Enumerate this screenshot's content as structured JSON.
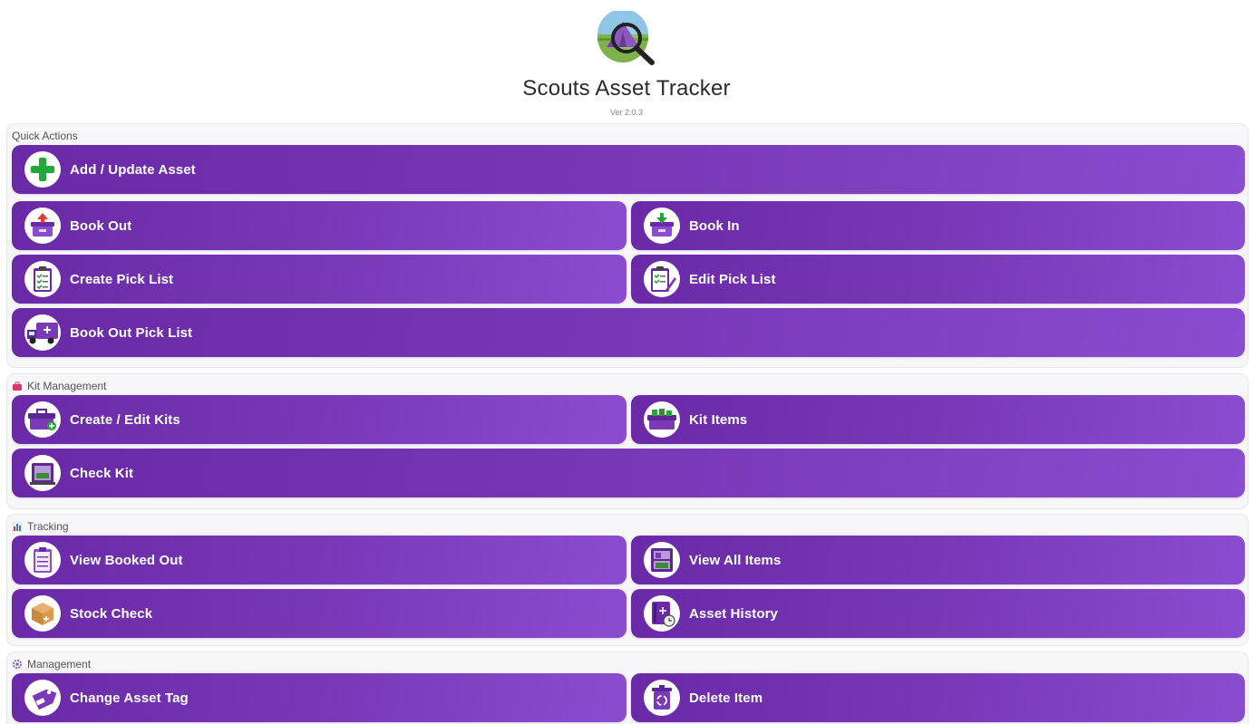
{
  "header": {
    "title": "Scouts Asset Tracker",
    "version": "Ver 2.0.3"
  },
  "sections": {
    "quick": {
      "title": "Quick Actions",
      "buttons": {
        "add_update": "Add / Update Asset",
        "book_out": "Book Out",
        "book_in": "Book In",
        "create_pick": "Create Pick List",
        "edit_pick": "Edit Pick List",
        "book_out_pick": "Book Out Pick List"
      }
    },
    "kit": {
      "title": "Kit Management",
      "buttons": {
        "create_edit_kits": "Create / Edit Kits",
        "kit_items": "Kit Items",
        "check_kit": "Check Kit"
      }
    },
    "tracking": {
      "title": "Tracking",
      "buttons": {
        "view_booked_out": "View Booked Out",
        "view_all_items": "View All Items",
        "stock_check": "Stock Check",
        "asset_history": "Asset History"
      }
    },
    "management": {
      "title": "Management",
      "buttons": {
        "change_asset_tag": "Change Asset Tag",
        "delete_item": "Delete Item"
      }
    }
  },
  "colors": {
    "button_start": "#6a2aa8",
    "button_end": "#8a4dd0",
    "section_bg": "#f7f7fa"
  },
  "icons": {
    "logo": "tent-magnifier-logo",
    "add_update": "plus-icon",
    "book_out": "box-upload-icon",
    "book_in": "box-download-icon",
    "create_pick": "clipboard-checklist-icon",
    "edit_pick": "clipboard-edit-icon",
    "book_out_pick": "truck-icon",
    "create_edit_kits": "toolbox-add-icon",
    "kit_items": "toolbox-items-icon",
    "check_kit": "kit-check-icon",
    "view_booked_out": "clipboard-list-icon",
    "view_all_items": "shelf-icon",
    "stock_check": "cardboard-box-icon",
    "asset_history": "book-clock-icon",
    "change_asset_tag": "tag-icon",
    "delete_item": "recycle-bin-icon"
  }
}
